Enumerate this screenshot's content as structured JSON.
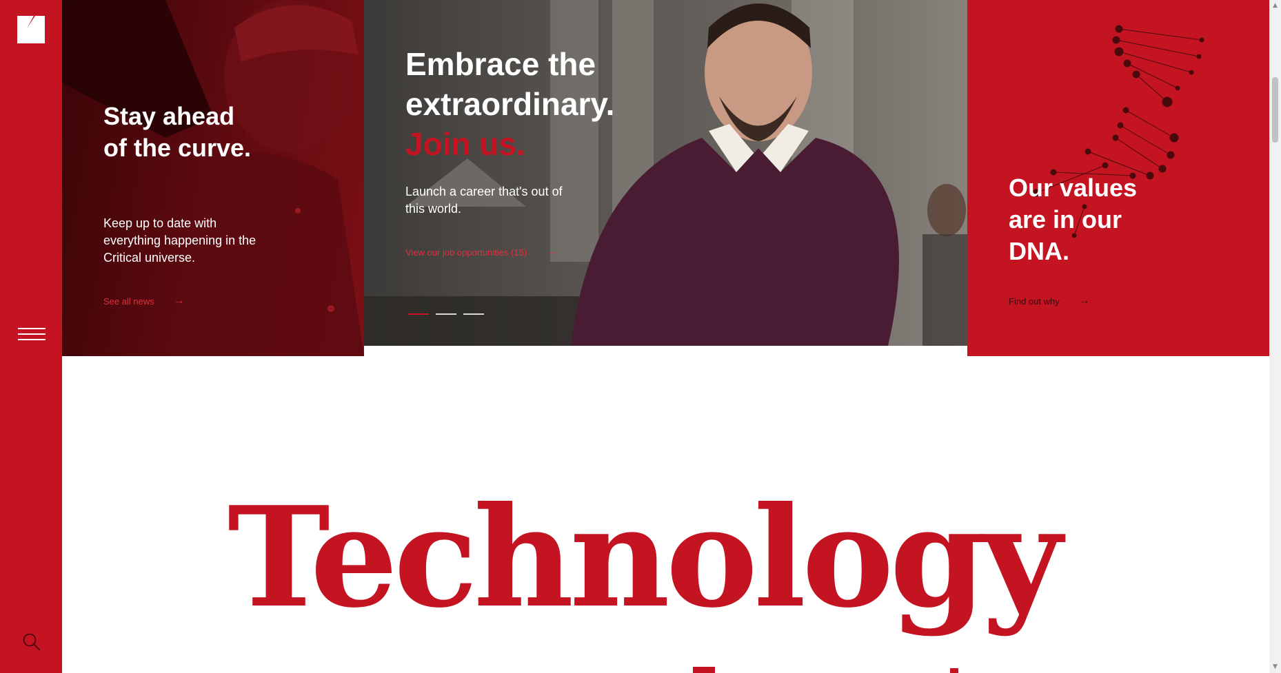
{
  "sidebar": {
    "logo_icon": "brand-logo-icon",
    "menu_icon": "hamburger-menu-icon",
    "search_icon": "search-icon"
  },
  "news_panel": {
    "title": "Stay ahead of the curve.",
    "text": "Keep up to date with everything happening in the Critical universe.",
    "link": "See all news",
    "link_icon": "arrow-right-icon"
  },
  "hero": {
    "title_line1": "Embrace the",
    "title_line2": "extraordinary.",
    "title_accent": "Join us.",
    "text": "Launch a career that's out of this world.",
    "link": "View our job opportunities (15)",
    "link_icon": "arrow-right-icon",
    "slides_total": 3,
    "slide_active": 1
  },
  "values_panel": {
    "title": "Our values are in our DNA.",
    "link": "Find out why",
    "link_icon": "arrow-right-icon"
  },
  "section": {
    "big_word": "Technology"
  },
  "colors": {
    "brand_red": "#c41422",
    "white": "#ffffff"
  }
}
